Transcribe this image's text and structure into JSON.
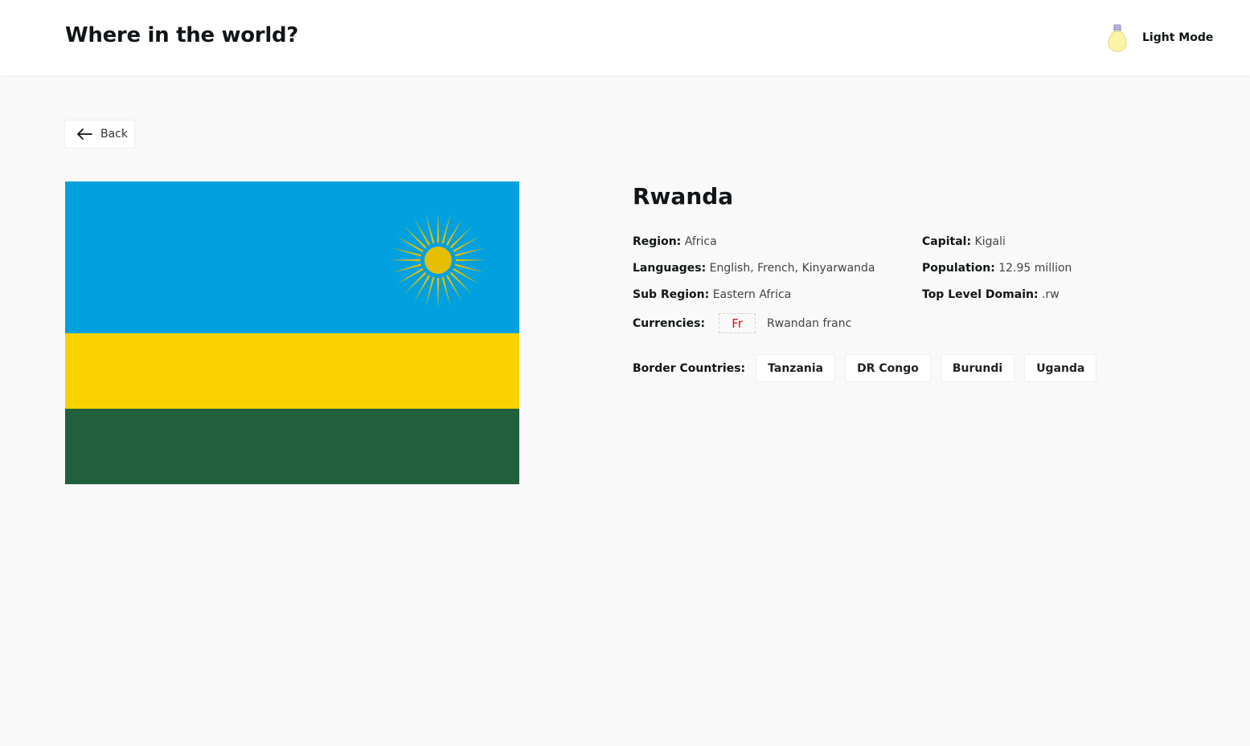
{
  "header": {
    "title": "Where in the world?",
    "mode_label": "Light Mode",
    "mode_icon": "lightbulb-icon"
  },
  "back_button": {
    "label": "Back",
    "icon": "arrow-left-icon"
  },
  "country": {
    "name": "Rwanda",
    "flag": {
      "description_icon": "rwanda-flag",
      "colors": {
        "sky": "#00A1DE",
        "yellow": "#FAD201",
        "green": "#20603D",
        "sun": "#E5BE01"
      }
    },
    "facts_left": [
      {
        "label": "Region:",
        "value": "Africa"
      },
      {
        "label": "Languages:",
        "value": "English, French, Kinyarwanda"
      },
      {
        "label": "Sub Region:",
        "value": "Eastern Africa"
      }
    ],
    "facts_right": [
      {
        "label": "Capital:",
        "value": "Kigali"
      },
      {
        "label": "Population:",
        "value": "12.95 million"
      },
      {
        "label": "Top Level Domain:",
        "value": ".rw"
      }
    ],
    "currencies": {
      "label": "Currencies:",
      "symbol": "Fr",
      "name": "Rwandan franc"
    },
    "borders": {
      "label": "Border Countries:",
      "items": [
        "Tanzania",
        "DR Congo",
        "Burundi",
        "Uganda"
      ]
    }
  }
}
